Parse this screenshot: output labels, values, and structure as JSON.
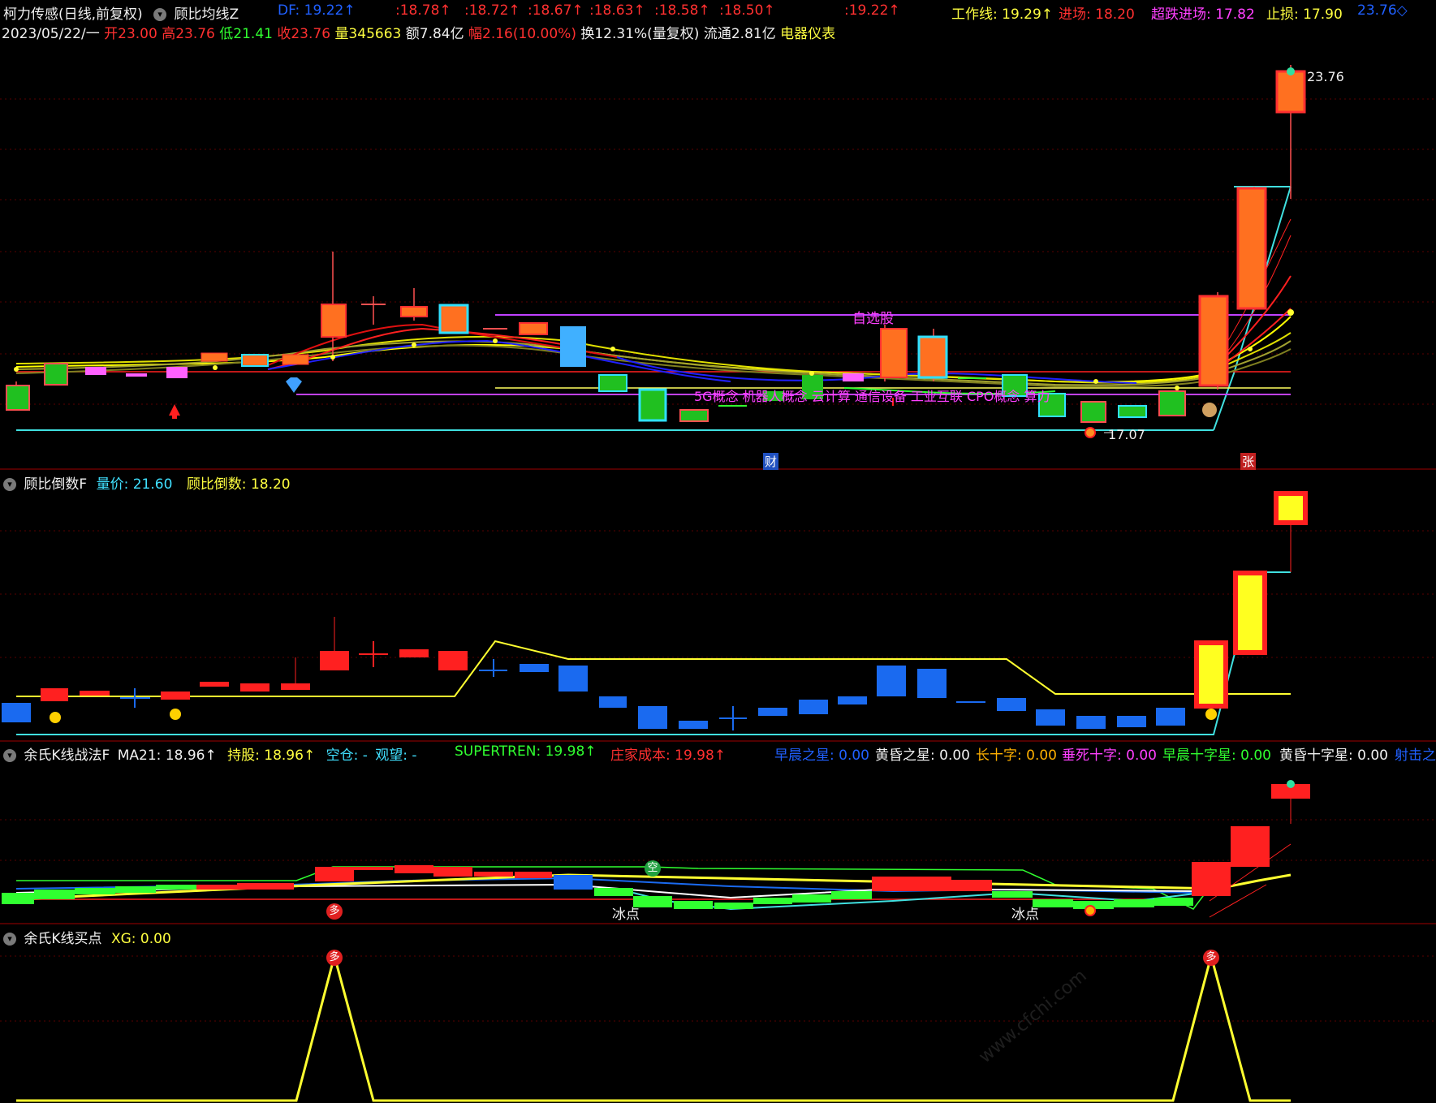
{
  "header": {
    "stock": "柯力传感(日线,前复权)",
    "indicator": "顾比均线Z",
    "df": "DF: 19.22↑",
    "mas": [
      ":18.78↑",
      ":18.72↑",
      ":18.67↑",
      ":18.63↑",
      ":18.58↑",
      ":18.50↑",
      ":19.22↑"
    ],
    "work_line": "工作线: 19.29↑",
    "entry": "进场: 18.20",
    "oversold": "超跌进场: 17.82",
    "stop": "止损: 17.90",
    "last_val": "23.76◇"
  },
  "quote": {
    "date": "2023/05/22/一",
    "open": "开23.00",
    "high": "高23.76",
    "low": "低21.41",
    "close": "收23.76",
    "volume": "量345663",
    "amount": "额7.84亿",
    "change": "幅2.16(10.00%)",
    "turnover": "换12.31%(量复权)",
    "float": "流通2.81亿",
    "sector": "电器仪表"
  },
  "main_chart": {
    "high_label": "23.76",
    "low_label": "17.07",
    "zixuan": "自选股",
    "concepts": "5G概念  机器人概念  云计算  通信设备  工业互联  CPO概念  算力",
    "cai": "财",
    "zhang": "张"
  },
  "panel2": {
    "name": "顾比倒数F",
    "liangjia": "量价: 21.60",
    "daoshu": "顾比倒数: 18.20"
  },
  "panel3": {
    "name": "余氏K线战法F",
    "ma21": "MA21: 18.96↑",
    "chigu": "持股: 18.96↑",
    "kongcang": "空仓: -",
    "guanwang": "观望: -",
    "supertrend": "SUPERTREN: 19.98↑",
    "zhuangjia": "庄家成本: 19.98↑",
    "zaochen": "早晨之星: 0.00",
    "huanghun": "黄昏之星: 0.00",
    "changshizi": "长十字: 0.00",
    "chuisi": "垂死十字: 0.00",
    "zaochenshizi": "早晨十字星: 0.00",
    "huanghunshizi": "黄昏十字星: 0.00",
    "shejizhi": "射击之",
    "duo": "多",
    "kong": "空",
    "bingdian1": "冰点",
    "bingdian2": "冰点"
  },
  "panel4": {
    "name": "余氏K线买点",
    "xg": "XG: 0.00",
    "duo1": "多",
    "duo2": "多"
  },
  "watermark": "www.cfchi.com",
  "chart_data": {
    "type": "candlestick",
    "title": "柯力传感(日线,前复权)",
    "last_candle": {
      "date": "2023/05/22",
      "open": 23.0,
      "high": 23.76,
      "low": 21.41,
      "close": 23.76
    },
    "annotated_high": 23.76,
    "annotated_low": 17.07,
    "gmma_short": [
      18.78,
      18.72,
      18.67,
      18.63,
      18.58,
      18.5
    ],
    "df": 19.22,
    "xg_signal_peaks": 2
  }
}
